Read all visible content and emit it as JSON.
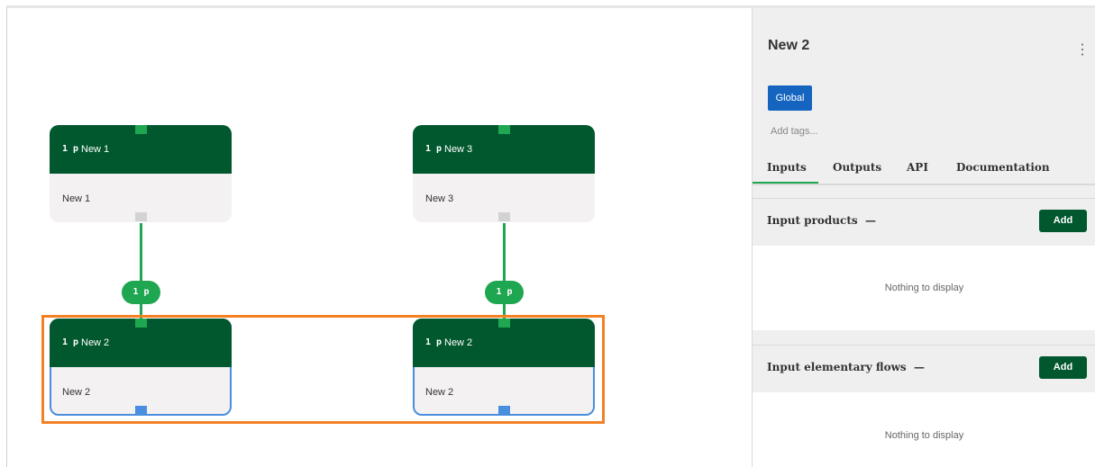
{
  "canvas": {
    "nodes": [
      {
        "qty": "1 p",
        "title": "New 1",
        "body": "New 1"
      },
      {
        "qty": "1 p",
        "title": "New 3",
        "body": "New 3"
      },
      {
        "qty": "1 p",
        "title": "New 2",
        "body": "New 2"
      },
      {
        "qty": "1 p",
        "title": "New 2",
        "body": "New 2"
      }
    ],
    "edges": [
      {
        "label": "1 p"
      },
      {
        "label": "1 p"
      }
    ]
  },
  "panel": {
    "title": "New 2",
    "menu_icon": "kebab-menu-icon",
    "tag": "Global",
    "tags_placeholder": "Add tags...",
    "tabs": [
      "Inputs",
      "Outputs",
      "API",
      "Documentation"
    ],
    "active_tab": "Inputs",
    "sections": [
      {
        "title": "Input products",
        "collapse": "—",
        "add_label": "Add",
        "empty_text": "Nothing to display"
      },
      {
        "title": "Input elementary flows",
        "collapse": "—",
        "add_label": "Add",
        "empty_text": "Nothing to display"
      }
    ]
  },
  "colors": {
    "node_header": "#01582e",
    "accent_green": "#1fa650",
    "selection": "#f48024",
    "selected_border": "#4a8ee0",
    "tag_blue": "#1565c0"
  }
}
